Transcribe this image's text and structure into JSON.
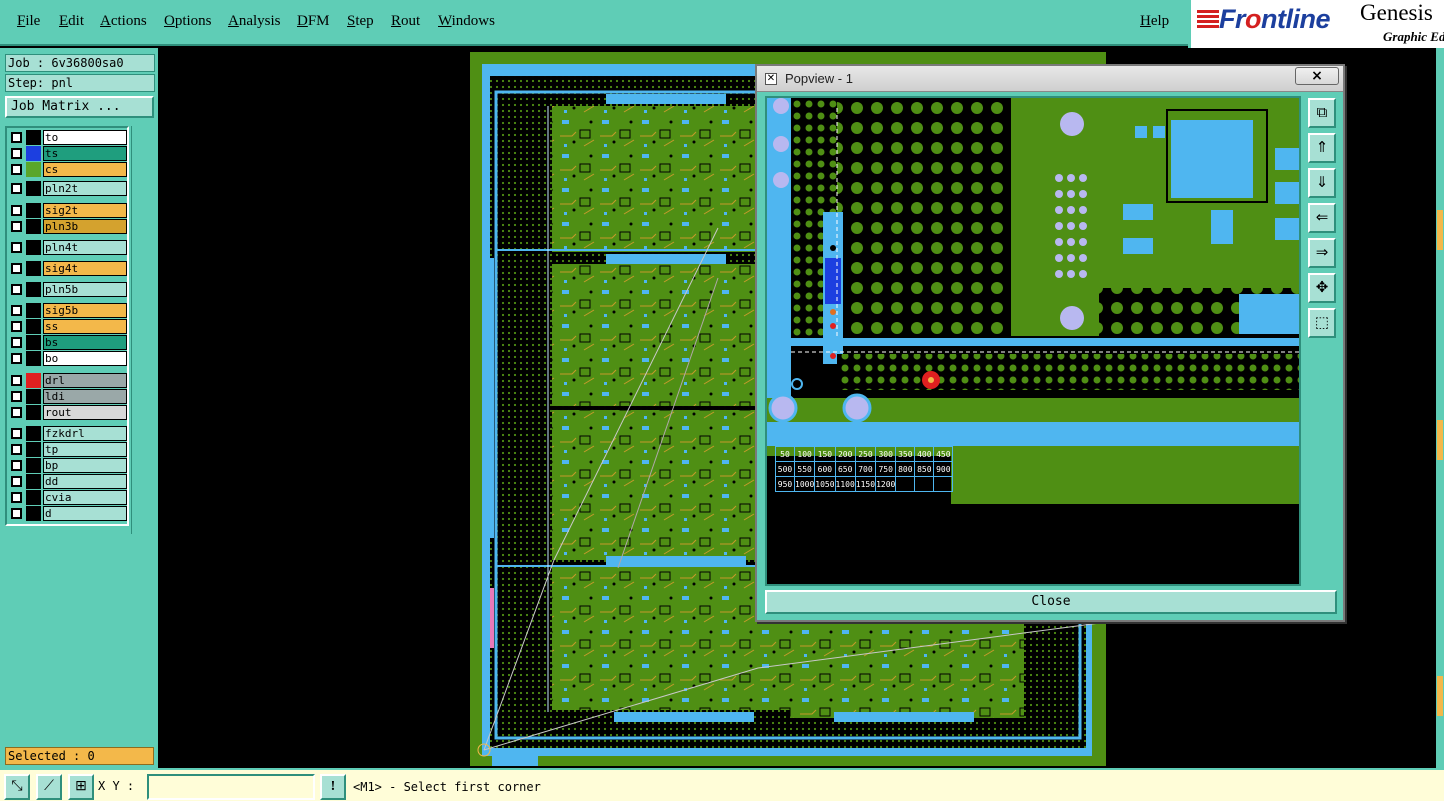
{
  "menu": {
    "items": [
      "File",
      "Edit",
      "Actions",
      "Options",
      "Analysis",
      "DFM",
      "Step",
      "Rout",
      "Windows"
    ],
    "help": "Help"
  },
  "logo": {
    "brand_pre": "Fr",
    "brand_o": "o",
    "brand_post": "ntline",
    "product": "Genesis",
    "subtitle": "Graphic Editor"
  },
  "job": {
    "job_label": "Job : 6v36800sa0",
    "step_label": "Step: pnl",
    "matrix_button": "Job Matrix ..."
  },
  "layers": [
    {
      "name": "to",
      "swatch": "#000000",
      "color": "#ffffff"
    },
    {
      "name": "ts",
      "swatch": "#1c3fe0",
      "color": "#1f9e7e"
    },
    {
      "name": "cs",
      "swatch": "#5aa62a",
      "color": "#f3b84a"
    },
    {
      "name": "pln2t",
      "swatch": "#000000",
      "color": "#a7e0d4"
    },
    {
      "name": "sig2t",
      "swatch": "#000000",
      "color": "#f3b84a"
    },
    {
      "name": "pln3b",
      "swatch": "#000000",
      "color": "#d4a22e"
    },
    {
      "name": "pln4t",
      "swatch": "#000000",
      "color": "#a7e0d4"
    },
    {
      "name": "sig4t",
      "swatch": "#000000",
      "color": "#f3b84a"
    },
    {
      "name": "pln5b",
      "swatch": "#000000",
      "color": "#a7e0d4"
    },
    {
      "name": "sig5b",
      "swatch": "#000000",
      "color": "#f3b84a"
    },
    {
      "name": "ss",
      "swatch": "#000000",
      "color": "#f3b84a"
    },
    {
      "name": "bs",
      "swatch": "#000000",
      "color": "#1f9e7e"
    },
    {
      "name": "bo",
      "swatch": "#000000",
      "color": "#ffffff"
    },
    {
      "name": "drl",
      "swatch": "#e02020",
      "color": "#9aa8a8"
    },
    {
      "name": "ldi",
      "swatch": "#000000",
      "color": "#9aa8a8"
    },
    {
      "name": "rout",
      "swatch": "#000000",
      "color": "#d8d8d8"
    },
    {
      "name": "fzkdrl",
      "swatch": "#000000",
      "color": "#a7e0d4"
    },
    {
      "name": "tp",
      "swatch": "#000000",
      "color": "#a7e0d4"
    },
    {
      "name": "bp",
      "swatch": "#000000",
      "color": "#a7e0d4"
    },
    {
      "name": "dd",
      "swatch": "#000000",
      "color": "#a7e0d4"
    },
    {
      "name": "cvia",
      "swatch": "#000000",
      "color": "#a7e0d4"
    },
    {
      "name": "d",
      "swatch": "#000000",
      "color": "#a7e0d4"
    }
  ],
  "selected_label": "Selected : 0",
  "popview": {
    "title": "Popview - 1",
    "close_x": "×",
    "close_button": "Close",
    "tools": [
      "zoom-window-icon",
      "pan-up-icon",
      "pan-down-icon",
      "pan-left-icon",
      "pan-right-icon",
      "zoom-fit-icon",
      "zoom-home-icon"
    ],
    "legend_rows": [
      [
        "50",
        "100",
        "150",
        "200",
        "250",
        "300",
        "350",
        "400",
        "450"
      ],
      [
        "500",
        "550",
        "600",
        "650",
        "700",
        "750",
        "800",
        "850",
        "900"
      ],
      [
        "950",
        "1000",
        "1050",
        "1100",
        "1150",
        "1200",
        "",
        "",
        ""
      ]
    ]
  },
  "status": {
    "xy_label": "X Y :",
    "xy_value": "",
    "warn": "!",
    "message": "<M1> - Select first corner"
  },
  "colors": {
    "ui": "#5fcdb6",
    "board_green": "#4f8f14",
    "copper_blue": "#4fb6f0",
    "highlight": "#f3b84a"
  }
}
